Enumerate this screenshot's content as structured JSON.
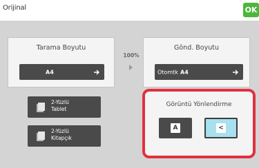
{
  "header": {
    "title": "Orijinal",
    "ok_label": "OK"
  },
  "scan_size": {
    "label": "Tarama Boyutu",
    "value": "A4"
  },
  "ratio": "100%",
  "send_size": {
    "label": "Gönd. Boyutu",
    "mode": "Otomtk",
    "value": "A4"
  },
  "duplex": [
    {
      "line1": "2-Yüzlü",
      "line2": "Tablet"
    },
    {
      "line1": "2-Yüzlü",
      "line2": "Kitapçık"
    }
  ],
  "orientation": {
    "label": "Görüntü Yönlendirme",
    "options": [
      {
        "glyph": "A",
        "selected": false
      },
      {
        "glyph": "<",
        "selected": true
      }
    ]
  },
  "colors": {
    "ok": "#4bb83a",
    "highlight": "#e2303f",
    "selected": "#a8e0ef",
    "button": "#4a4a4a"
  }
}
